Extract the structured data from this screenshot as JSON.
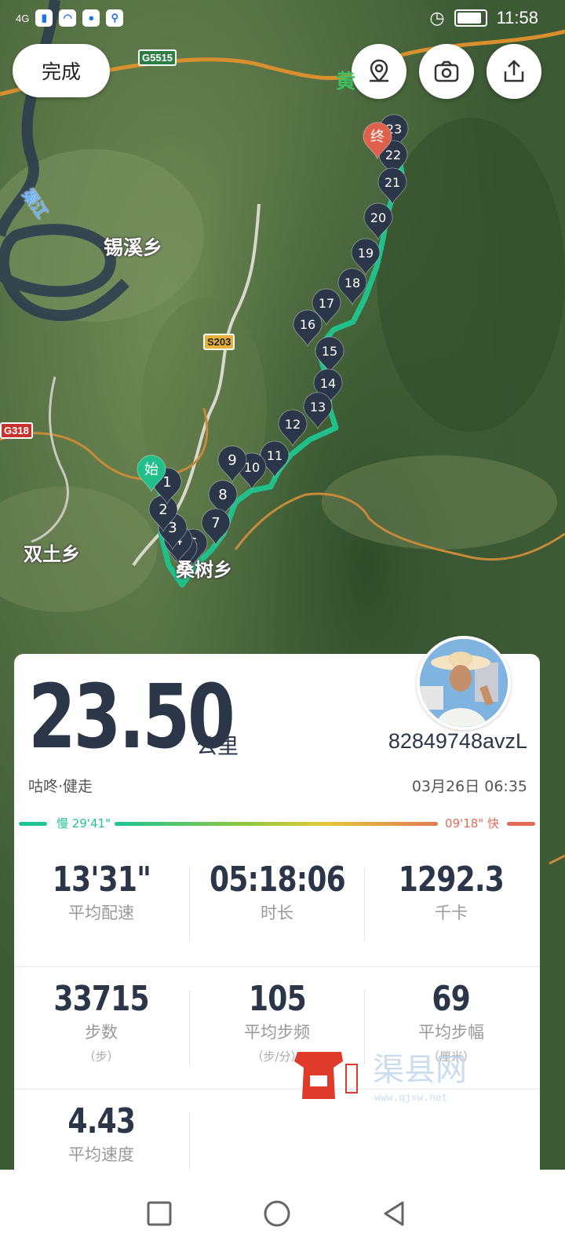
{
  "status_bar": {
    "time": "11:58",
    "network": "4G"
  },
  "top_bar": {
    "done_label": "完成"
  },
  "map": {
    "place_labels": [
      "锡溪乡",
      "双土乡",
      "桑树乡",
      "黄"
    ],
    "river_label": "渠江",
    "road_tags": [
      "G5515",
      "S203",
      "G318"
    ],
    "start_marker": "始",
    "end_marker": "终",
    "km_markers": [
      "1",
      "2",
      "3",
      "4",
      "5",
      "6",
      "7",
      "8",
      "9",
      "10",
      "11",
      "12",
      "13",
      "14",
      "15",
      "16",
      "17",
      "18",
      "19",
      "20",
      "21",
      "22",
      "23"
    ],
    "route_color": "#21c08b",
    "end_color": "#e0604e",
    "marker_color": "#2b3649"
  },
  "summary": {
    "distance": "23.50",
    "distance_unit": "公里",
    "username": "82849748avzL",
    "activity": "咕咚·健走",
    "datetime": "03月26日 06:35",
    "pace_slow": "慢 29'41\"",
    "pace_fast": "09'18\" 快"
  },
  "stats": [
    {
      "value": "13'31\"",
      "label": "平均配速",
      "sub": ""
    },
    {
      "value": "05:18:06",
      "label": "时长",
      "sub": ""
    },
    {
      "value": "1292.3",
      "label": "千卡",
      "sub": ""
    },
    {
      "value": "33715",
      "label": "步数",
      "sub": "（步）"
    },
    {
      "value": "105",
      "label": "平均步频",
      "sub": "（步/分）"
    },
    {
      "value": "69",
      "label": "平均步幅",
      "sub": "（厘米）"
    },
    {
      "value": "4.43",
      "label": "平均速度",
      "sub": ""
    }
  ],
  "watermark": {
    "text": "渠县网",
    "url": "www.qjxw.net"
  }
}
